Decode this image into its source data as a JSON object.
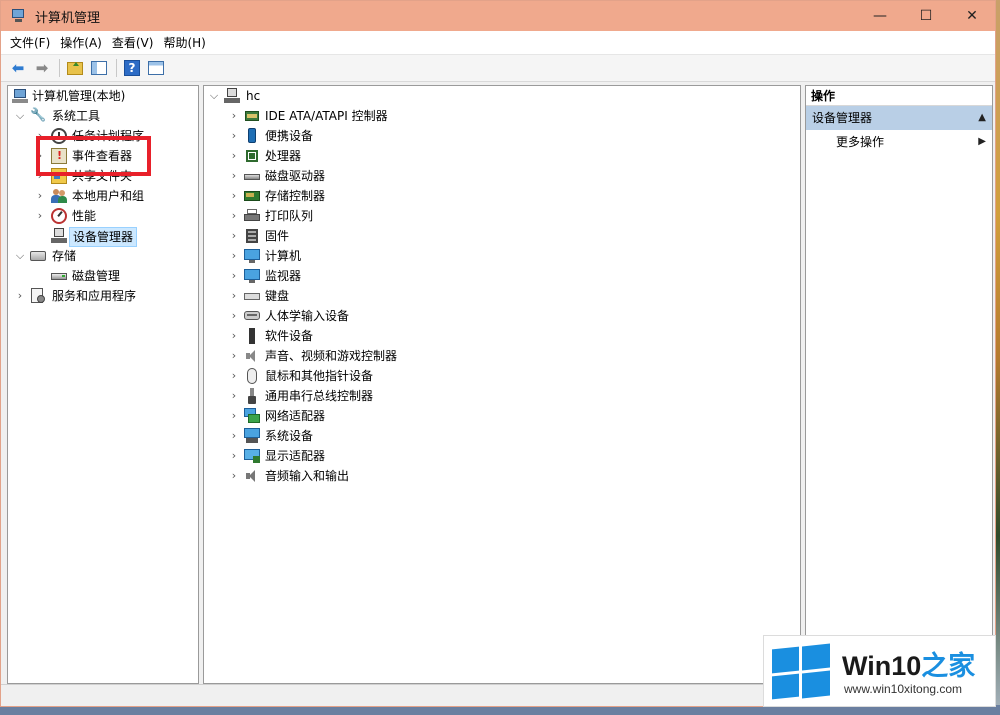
{
  "window": {
    "title": "计算机管理",
    "controls": {
      "minimize": "—",
      "maximize": "☐",
      "close": "✕"
    }
  },
  "menubar": [
    "文件(F)",
    "操作(A)",
    "查看(V)",
    "帮助(H)"
  ],
  "toolbar": {
    "help_glyph": "?"
  },
  "tree": {
    "root": "计算机管理(本地)",
    "system_tools": "系统工具",
    "task_scheduler": "任务计划程序",
    "event_viewer": "事件查看器",
    "shared_folders": "共享文件夹",
    "local_users": "本地用户和组",
    "performance": "性能",
    "device_manager": "设备管理器",
    "storage": "存储",
    "disk_management": "磁盘管理",
    "services_apps": "服务和应用程序"
  },
  "devices": {
    "computer_name": "hc",
    "items": [
      {
        "label": "IDE ATA/ATAPI 控制器",
        "icon": "ide-controller-icon"
      },
      {
        "label": "便携设备",
        "icon": "portable-device-icon"
      },
      {
        "label": "处理器",
        "icon": "processor-icon"
      },
      {
        "label": "磁盘驱动器",
        "icon": "disk-drive-icon"
      },
      {
        "label": "存储控制器",
        "icon": "storage-controller-icon"
      },
      {
        "label": "打印队列",
        "icon": "printer-icon"
      },
      {
        "label": "固件",
        "icon": "firmware-icon"
      },
      {
        "label": "计算机",
        "icon": "computer-icon"
      },
      {
        "label": "监视器",
        "icon": "monitor-icon"
      },
      {
        "label": "键盘",
        "icon": "keyboard-icon"
      },
      {
        "label": "人体学输入设备",
        "icon": "hid-icon"
      },
      {
        "label": "软件设备",
        "icon": "software-device-icon"
      },
      {
        "label": "声音、视频和游戏控制器",
        "icon": "sound-icon"
      },
      {
        "label": "鼠标和其他指针设备",
        "icon": "mouse-icon"
      },
      {
        "label": "通用串行总线控制器",
        "icon": "usb-icon"
      },
      {
        "label": "网络适配器",
        "icon": "network-adapter-icon"
      },
      {
        "label": "系统设备",
        "icon": "system-device-icon"
      },
      {
        "label": "显示适配器",
        "icon": "display-adapter-icon"
      },
      {
        "label": "音频输入和输出",
        "icon": "audio-io-icon"
      }
    ]
  },
  "actions": {
    "header": "操作",
    "section": "设备管理器",
    "more": "更多操作"
  },
  "watermark": {
    "title_prefix": "Win10",
    "title_suffix": "之家",
    "url": "www.win10xitong.com"
  },
  "colors": {
    "titlebar": "#f0a98d",
    "selection": "#cce8ff",
    "highlight_box": "#e8202a",
    "action_section": "#b9cfe6",
    "brand_blue": "#1a8fe0"
  }
}
